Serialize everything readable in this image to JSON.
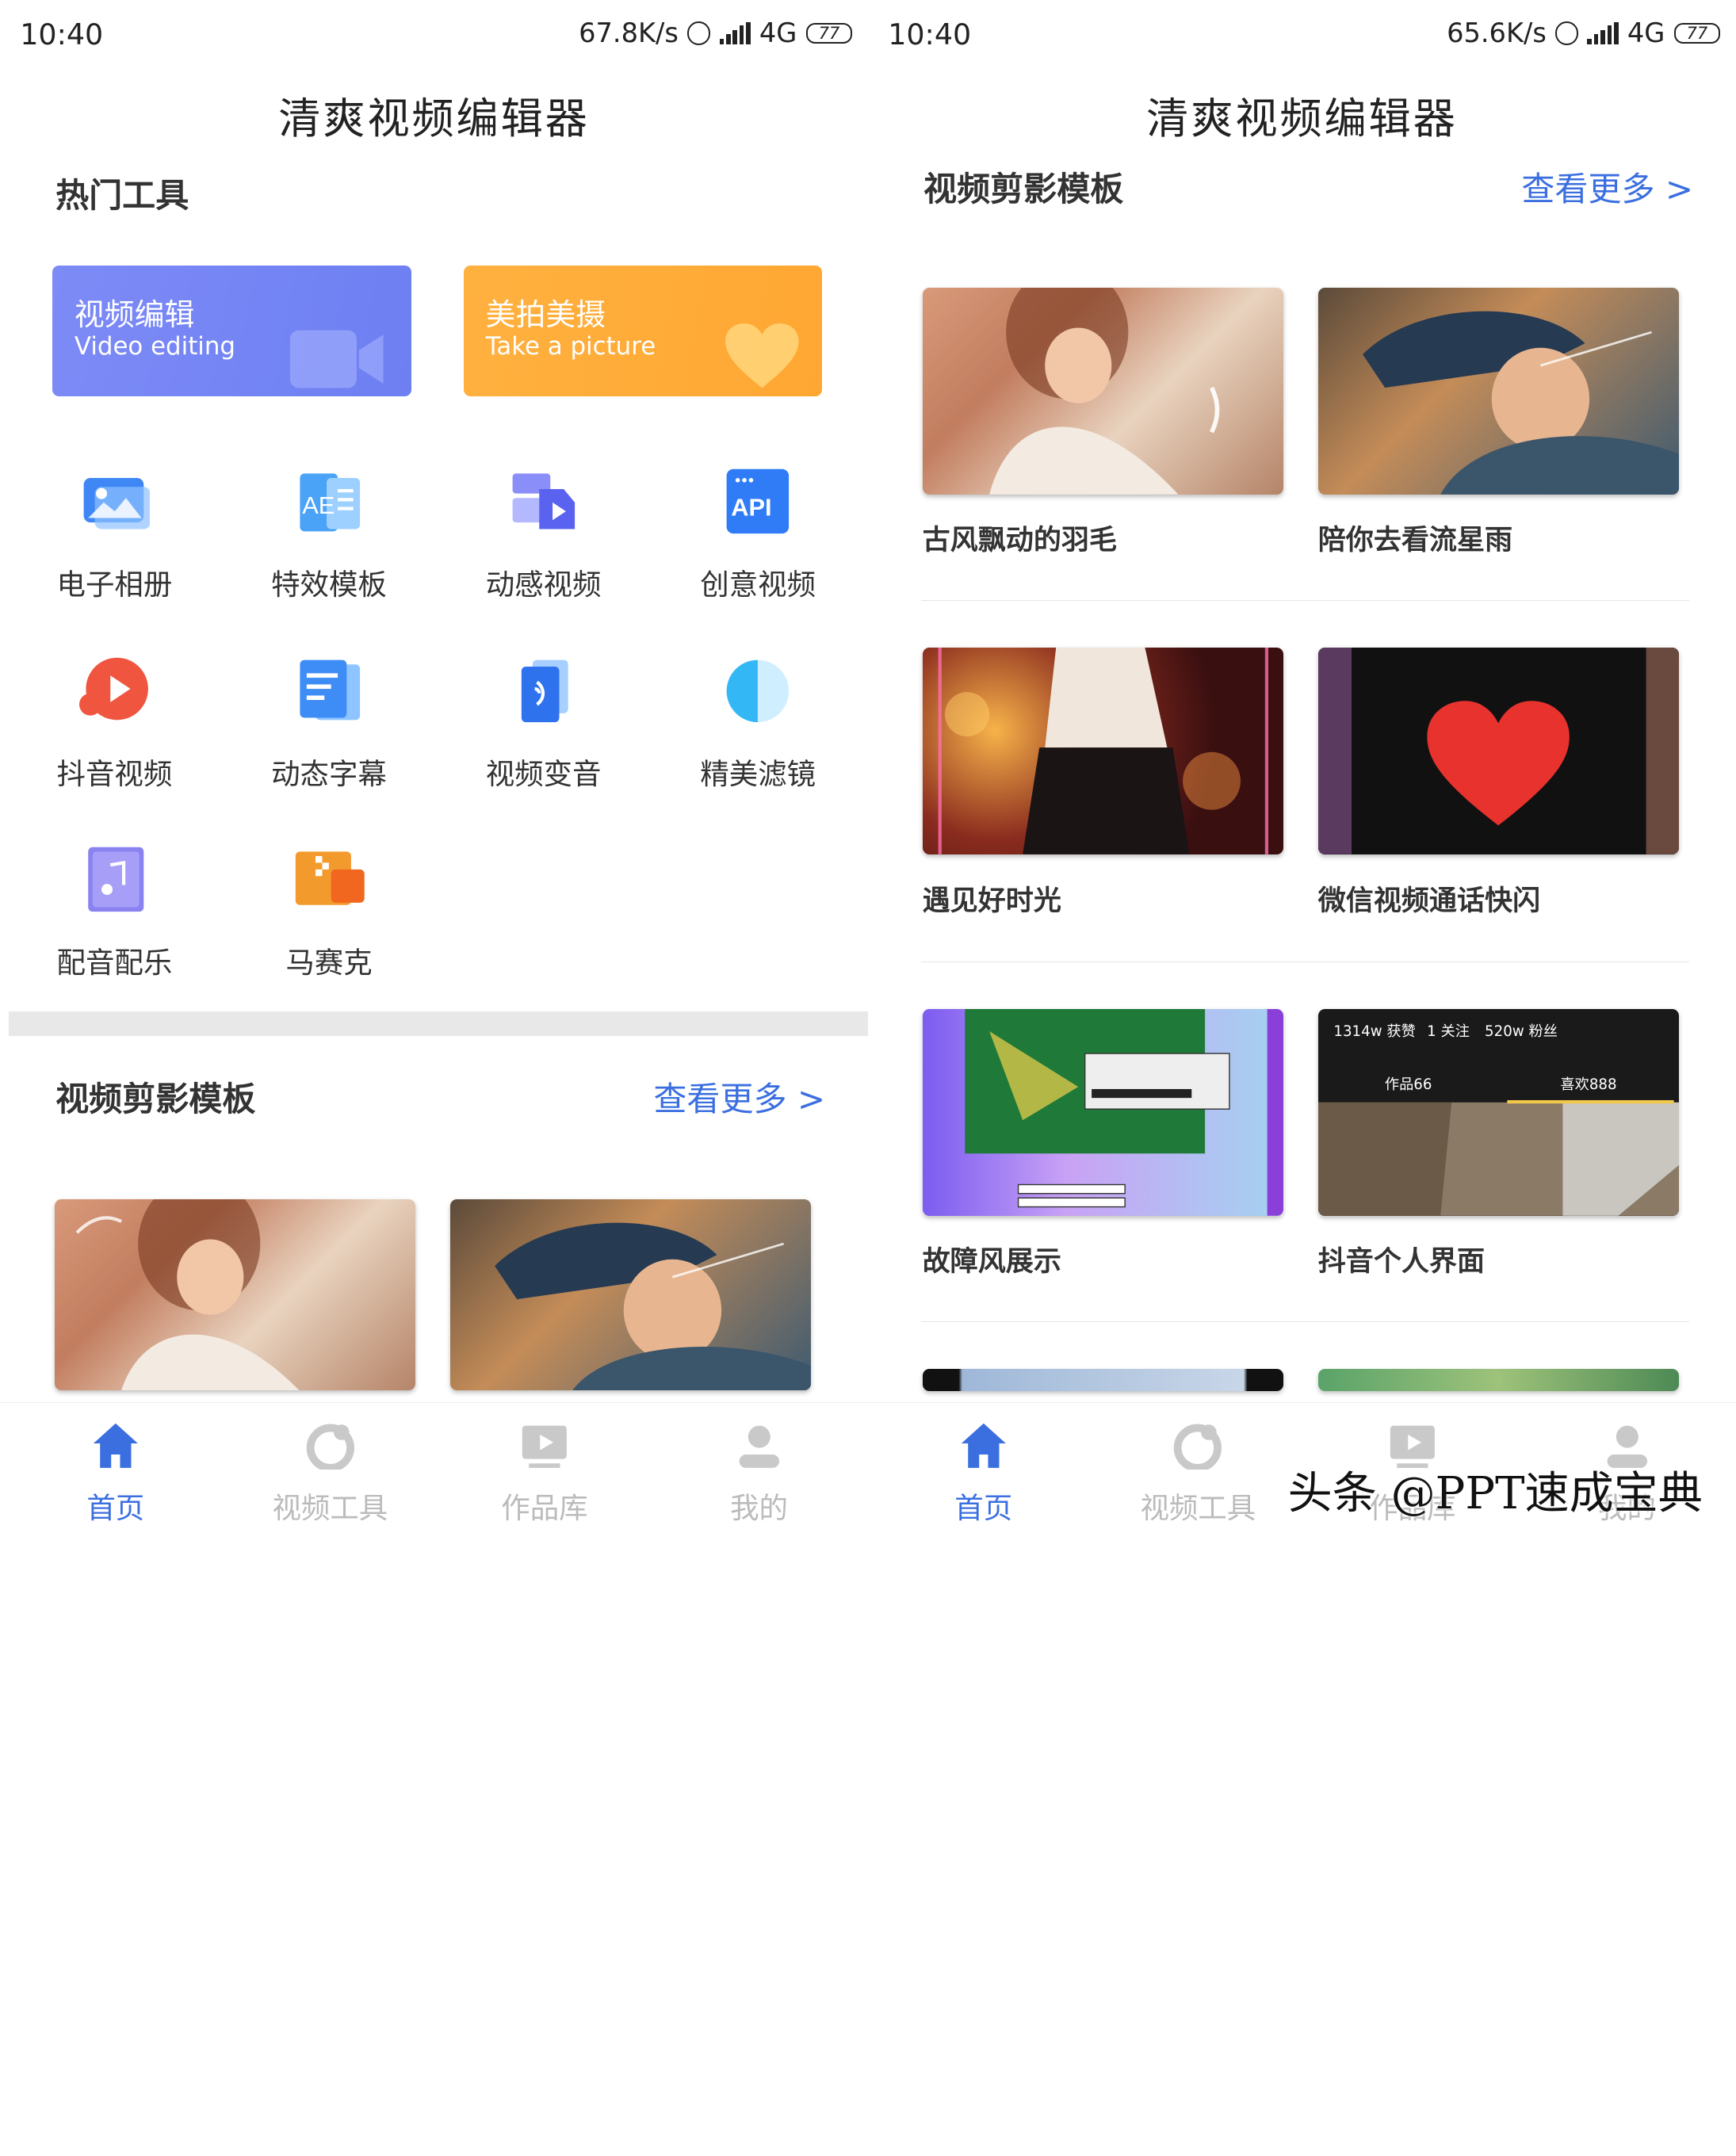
{
  "status_left": {
    "time": "10:40",
    "speed": "67.8K/s",
    "network": "4G",
    "battery": "77"
  },
  "status_right": {
    "time": "10:40",
    "speed": "65.6K/s",
    "network": "4G",
    "battery": "77"
  },
  "app_title": "清爽视频编辑器",
  "hot_tools": {
    "title": "热门工具",
    "cards": [
      {
        "cn": "视频编辑",
        "en": "Video editing",
        "color": "#7b85f5"
      },
      {
        "cn": "美拍美摄",
        "en": "Take a picture",
        "color": "#ffae3c"
      }
    ],
    "items": [
      {
        "label": "电子相册",
        "icon": "photo-album-icon"
      },
      {
        "label": "特效模板",
        "icon": "effects-template-icon"
      },
      {
        "label": "动感视频",
        "icon": "dynamic-video-icon"
      },
      {
        "label": "创意视频",
        "icon": "api-icon"
      },
      {
        "label": "抖音视频",
        "icon": "play-icon"
      },
      {
        "label": "动态字幕",
        "icon": "subtitle-icon"
      },
      {
        "label": "视频变音",
        "icon": "voice-change-icon"
      },
      {
        "label": "精美滤镜",
        "icon": "filter-icon"
      },
      {
        "label": "配音配乐",
        "icon": "music-icon"
      },
      {
        "label": "马赛克",
        "icon": "mosaic-icon"
      }
    ]
  },
  "templates": {
    "title": "视频剪影模板",
    "more": "查看更多 >",
    "items": [
      {
        "label": "古风飘动的羽毛"
      },
      {
        "label": "陪你去看流星雨"
      },
      {
        "label": "遇见好时光"
      },
      {
        "label": "微信视频通话快闪"
      },
      {
        "label": "故障风展示"
      },
      {
        "label": "抖音个人界面"
      }
    ],
    "profile_stats": {
      "likes": "1314w 获赞",
      "follow": "1 关注",
      "fans": "520w 粉丝",
      "works": "作品66",
      "favs": "喜欢888"
    }
  },
  "tabs": [
    {
      "label": "首页",
      "icon": "home-icon",
      "active": true
    },
    {
      "label": "视频工具",
      "icon": "video-tools-icon",
      "active": false
    },
    {
      "label": "作品库",
      "icon": "works-library-icon",
      "active": false
    },
    {
      "label": "我的",
      "icon": "profile-icon",
      "active": false
    }
  ],
  "watermark": "头条 @PPT速成宝典",
  "colors": {
    "accent": "#3b6fe0",
    "card_blue": "#7b85f5",
    "card_orange": "#ffae3c"
  }
}
